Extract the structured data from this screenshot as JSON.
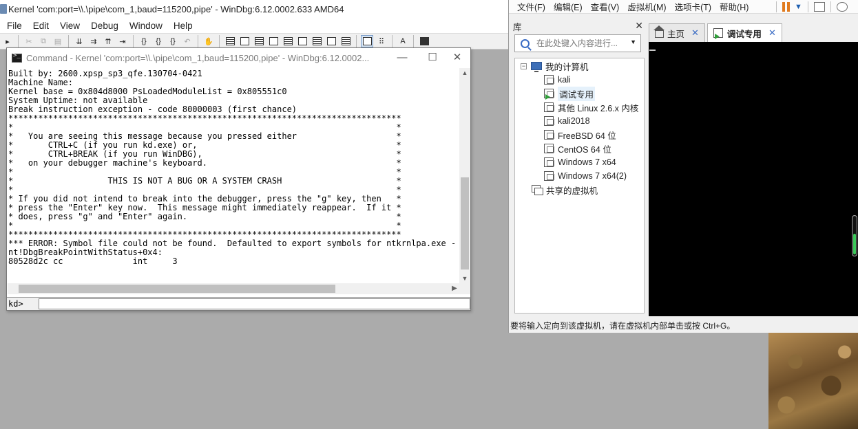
{
  "windbg": {
    "title": "Kernel 'com:port=\\\\.\\pipe\\com_1,baud=115200,pipe' - WinDbg:6.12.0002.633 AMD64",
    "menu": [
      "File",
      "Edit",
      "View",
      "Debug",
      "Window",
      "Help"
    ],
    "toolbar_icons": [
      "open-icon",
      "cut-icon",
      "copy-icon",
      "paste-icon",
      "step-into-icon",
      "step-over-icon",
      "step-out-icon",
      "run-to-cursor-icon",
      "break-icon",
      "hand-icon",
      "command-window-icon",
      "watch-icon",
      "locals-icon",
      "registers-icon",
      "memory-icon",
      "call-stack-icon",
      "disassembly-icon",
      "scratch-pad-icon",
      "source-mode-icon",
      "hex-mode-icon",
      "font-icon",
      "options-icon"
    ]
  },
  "command_window": {
    "title": "Command - Kernel 'com:port=\\\\.\\pipe\\com_1,baud=115200,pipe' - WinDbg:6.12.0002...",
    "output": "Built by: 2600.xpsp_sp3_qfe.130704-0421\nMachine Name:\nKernel base = 0x804d8000 PsLoadedModuleList = 0x805551c0\nSystem Uptime: not available\nBreak instruction exception - code 80000003 (first chance)\n*******************************************************************************\n*                                                                             *\n*   You are seeing this message because you pressed either                    *\n*       CTRL+C (if you run kd.exe) or,                                        *\n*       CTRL+BREAK (if you run WinDBG),                                       *\n*   on your debugger machine's keyboard.                                      *\n*                                                                             *\n*                   THIS IS NOT A BUG OR A SYSTEM CRASH                       *\n*                                                                             *\n* If you did not intend to break into the debugger, press the \"g\" key, then   *\n* press the \"Enter\" key now.  This message might immediately reappear.  If it *\n* does, press \"g\" and \"Enter\" again.                                          *\n*                                                                             *\n*******************************************************************************\n*** ERROR: Symbol file could not be found.  Defaulted to export symbols for ntkrnlpa.exe -\nnt!DbgBreakPointWithStatus+0x4:\n80528d2c cc              int     3",
    "prompt": "kd>",
    "input_value": ""
  },
  "vmware": {
    "menu": [
      "文件(F)",
      "编辑(E)",
      "查看(V)",
      "虚拟机(M)",
      "选项卡(T)",
      "帮助(H)"
    ],
    "library": {
      "title": "库",
      "search_placeholder": "在此处键入内容进行...",
      "root": "我的计算机",
      "vms": [
        "kali",
        "调试专用",
        "其他 Linux 2.6.x 内核",
        "kali2018",
        "FreeBSD 64 位",
        "CentOS 64 位",
        "Windows 7 x64",
        "Windows 7 x64(2)"
      ],
      "selected_vm": "调试专用",
      "shared": "共享的虚拟机"
    },
    "tabs": [
      {
        "label": "主页",
        "active": false
      },
      {
        "label": "调试专用",
        "active": true
      }
    ],
    "status": "要将输入定向到该虚拟机，请在虚拟机内部单击或按 Ctrl+G。",
    "colors": {
      "pause": "#e07b1f",
      "running": "#2fa03a",
      "accent": "#3a6cc4"
    }
  }
}
